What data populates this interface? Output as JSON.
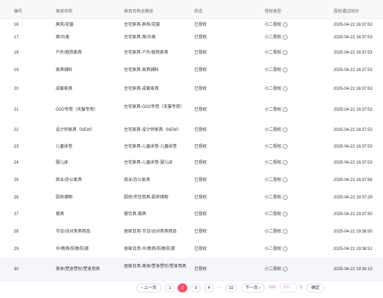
{
  "header": {
    "num": "编号",
    "name": "类目名称",
    "path": "类目名称全路径",
    "status": "状态",
    "auth_type": "授权类型",
    "auth_time": "授权通过时间"
  },
  "rows": [
    {
      "num": "16",
      "name": "屏风/花窗",
      "path": "住宅家具-屏风/花窗",
      "status": "已授权",
      "type": "小二授权",
      "time": "2025-04-22 16:37:53"
    },
    {
      "num": "17",
      "name": "案/台类",
      "path": "住宅家具-案/台类",
      "status": "已授权",
      "type": "小二授权",
      "time": "2025-04-22 16:37:53"
    },
    {
      "num": "18",
      "name": "户外/庭院家具",
      "path": "住宅家具-户外/庭院家具",
      "status": "已授权",
      "type": "小二授权",
      "time": "2025-04-22 16:37:53"
    },
    {
      "num": "19",
      "name": "家具辅料",
      "path": "住宅家具-家具辅料",
      "status": "已授权",
      "type": "小二授权",
      "time": "2025-04-22 16:37:53"
    },
    {
      "num": "20",
      "name": "成套家具",
      "path": "住宅家具-成套家具",
      "status": "已授权",
      "type": "小二授权",
      "time": "2025-04-22 16:37:53"
    },
    {
      "num": "21",
      "name": "O2O专用（天猫专用）",
      "path": "住宅家具-O2O专用（天猫专用）",
      "status": "已授权",
      "type": "小二授权",
      "time": "2025-04-22 16:37:53"
    },
    {
      "num": "22",
      "name": "设计师家具（NEW）",
      "path": "住宅家具-设计师家具（NEW）",
      "status": "已授权",
      "type": "小二授权",
      "time": "2025-04-22 16:37:53"
    },
    {
      "num": "23",
      "name": "儿童床垫",
      "path": "住宅家具-儿童床垫-儿童床垫",
      "status": "已授权",
      "type": "小二授权",
      "time": "2025-04-22 16:37:53"
    },
    {
      "num": "24",
      "name": "婴儿床",
      "path": "住宅家具-儿童床垫-婴儿床",
      "status": "已授权",
      "type": "小二授权",
      "time": "2025-04-22 16:37:53"
    },
    {
      "num": "25",
      "name": "商业/办公家具",
      "path": "商业/办公家具",
      "status": "已授权",
      "type": "小二授权",
      "time": "2025-04-22 16:37:56"
    },
    {
      "num": "26",
      "name": "厨房储物",
      "path": "厨房/烹饪用具-厨房储物",
      "status": "已授权",
      "type": "小二授权",
      "time": "2025-04-22 19:37:29"
    },
    {
      "num": "27",
      "name": "餐具",
      "path": "餐饮具-餐具",
      "status": "已授权",
      "type": "小二授权",
      "time": "2025-04-22 19:37:50"
    },
    {
      "num": "28",
      "name": "节日/派对夹具用品",
      "path": "居家日用-节日/派对夹具用品",
      "status": "已授权",
      "type": "小二授权",
      "time": "2025-04-22 19:38:50"
    },
    {
      "num": "29",
      "name": "伞/雨具/防雨/防潮",
      "path": "居家日用-伞/雨具/防雨/防潮",
      "status": "已授权",
      "type": "小二授权",
      "time": "2025-04-22 19:38:51"
    },
    {
      "num": "30",
      "name": "美体/塑身塑形/塑身用具",
      "path": "居家日用-美体/塑身塑形/塑身用具",
      "status": "已授权",
      "type": "小二授权",
      "time": "2025-04-22 19:39:10"
    }
  ],
  "pagination": {
    "prev": "‹ 上一页",
    "pages": [
      "1",
      "2",
      "3",
      "4",
      "···",
      "32"
    ],
    "next": "下一页 ›",
    "current": "2",
    "page_info": "2/32",
    "jump_placeholder": "页码",
    "page_suffix": "页",
    "confirm": "确定"
  }
}
